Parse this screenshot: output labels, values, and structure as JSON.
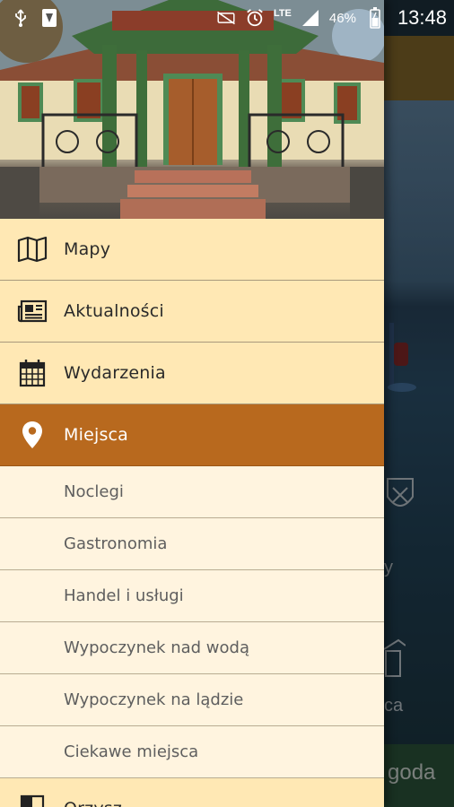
{
  "status_bar": {
    "lte_label": "LTE",
    "battery_percent": "46%",
    "time": "13:48"
  },
  "background": {
    "tile_left_text": "y",
    "tile_right_text": "ca",
    "bottom_text": "goda"
  },
  "drawer": {
    "menu": [
      {
        "label": "Mapy",
        "icon": "map-icon"
      },
      {
        "label": "Aktualności",
        "icon": "newspaper-icon"
      },
      {
        "label": "Wydarzenia",
        "icon": "calendar-icon"
      },
      {
        "label": "Miejsca",
        "icon": "location-pin-icon",
        "active": true
      }
    ],
    "submenu": [
      {
        "label": "Noclegi"
      },
      {
        "label": "Gastronomia"
      },
      {
        "label": "Handel i usługi"
      },
      {
        "label": "Wypoczynek nad wodą"
      },
      {
        "label": "Wypoczynek na lądzie"
      },
      {
        "label": "Ciekawe miejsca"
      }
    ],
    "after_menu": [
      {
        "label": "Orzysz",
        "icon": "crest-icon"
      }
    ]
  },
  "colors": {
    "menu_bg": "#ffe8b4",
    "active_bg": "#b8691e",
    "submenu_bg": "#fff4df"
  }
}
